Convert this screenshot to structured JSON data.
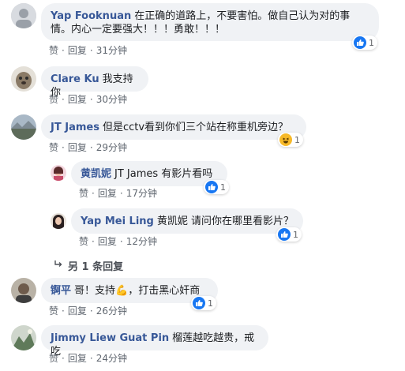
{
  "comments": [
    {
      "author": "Yap Fooknuan",
      "text": "在正确的道路上，不要害怕。做自己认为对的事情。内心一定要强大！！！勇敢！！！",
      "line1": "在正确的道路上，不要害怕。做自己认为对的事",
      "line2": "情。内心一定要强大！！！勇敢！！！",
      "like_label": "赞",
      "reply_label": "回复",
      "time": "31分钟",
      "reaction_icon": "like-icon",
      "reaction_count": "1"
    },
    {
      "author": "Clare Ku",
      "text": "我支持你",
      "like_label": "赞",
      "reply_label": "回复",
      "time": "30分钟"
    },
    {
      "author": "JT James",
      "text": "但是cctv看到你们三个站在称重机旁边？",
      "like_label": "赞",
      "reply_label": "回复",
      "time": "29分钟",
      "reaction_icon": "haha-icon",
      "reaction_count": "1"
    },
    {
      "author": "黄凯妮",
      "text": "JT James 有影片看吗",
      "like_label": "赞",
      "reply_label": "回复",
      "time": "17分钟",
      "reaction_icon": "like-icon",
      "reaction_count": "1"
    },
    {
      "author": "Yap Mei Ling",
      "text": "黄凯妮 请问你在哪里看影片？",
      "like_label": "赞",
      "reply_label": "回复",
      "time": "12分钟",
      "reaction_icon": "like-icon",
      "reaction_count": "1"
    },
    {
      "author": "锕平",
      "text": "哥！支持💪，打击黑心奸商",
      "like_label": "赞",
      "reply_label": "回复",
      "time": "26分钟",
      "reaction_icon": "like-icon",
      "reaction_count": "1"
    },
    {
      "author": "Jimmy Liew Guat Pin",
      "text": "榴莲越吃越贵，戒吃",
      "like_label": "赞",
      "reply_label": "回复",
      "time": "24分钟"
    }
  ],
  "more_replies": "另 1 条回复",
  "colors": {
    "author": "#385898",
    "bubble": "#f0f2f5",
    "like_blue": "#1877f2",
    "meta": "#606770"
  }
}
